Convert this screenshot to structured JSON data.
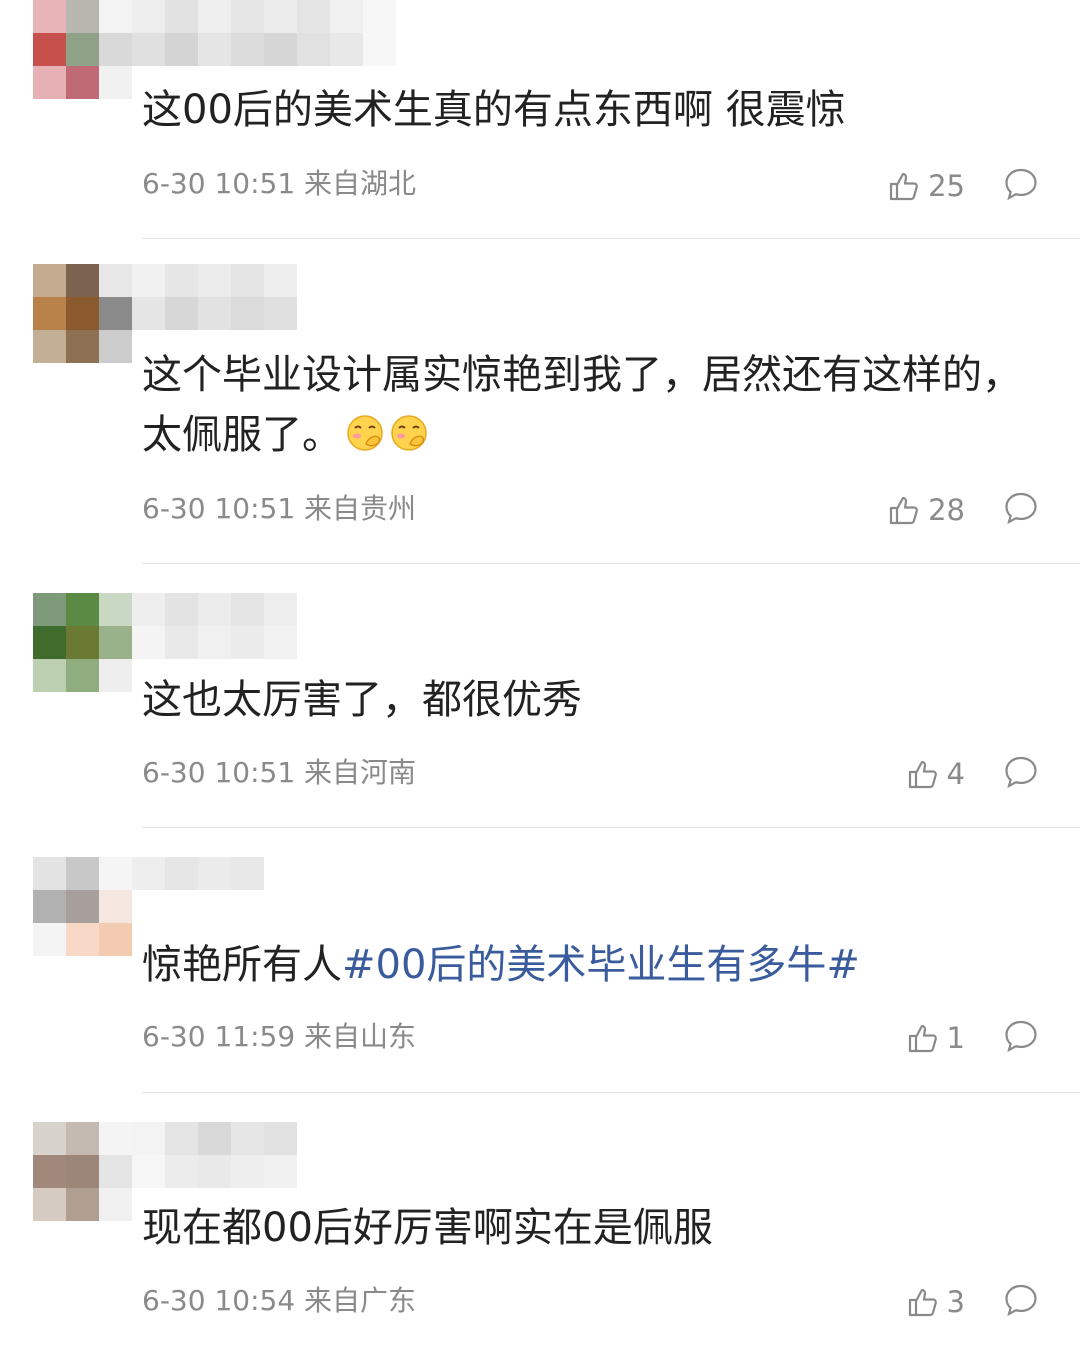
{
  "colors": {
    "text": "#222222",
    "meta": "#8a8a8a",
    "hashtag": "#3a5c9c",
    "divider": "#e6e6e6"
  },
  "icons": {
    "like": "thumbs-up-icon",
    "reply": "comment-bubble-icon",
    "emoji": "hand-over-face-emoji-icon"
  },
  "comments": [
    {
      "text": "这00后的美术生真的有点东西啊 很震惊",
      "time": "6-30 10:51",
      "location": "来自湖北",
      "likes": "25"
    },
    {
      "text": "这个毕业设计属实惊艳到我了，居然还有这样的，太佩服了。",
      "time": "6-30 10:51",
      "location": "来自贵州",
      "likes": "28"
    },
    {
      "text": "这也太厉害了，都很优秀",
      "time": "6-30 10:51",
      "location": "来自河南",
      "likes": "4"
    },
    {
      "text": "惊艳所有人",
      "hashtag": "#00后的美术毕业生有多牛#",
      "time": "6-30 11:59",
      "location": "来自山东",
      "likes": "1"
    },
    {
      "text": "现在都00后好厉害啊实在是佩服",
      "time": "6-30 10:54",
      "location": "来自广东",
      "likes": "3"
    }
  ]
}
